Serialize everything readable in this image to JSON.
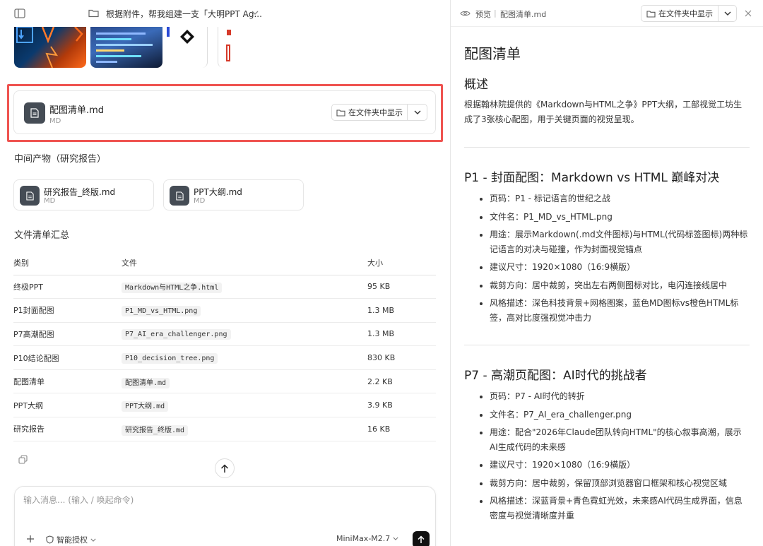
{
  "topbar": {
    "conversation_title": "根据附件，帮我组建一支「大明PPT Ag..."
  },
  "thumbnails": [
    "cover-thumbnail",
    "code-thumbnail",
    "decision-tree-thumbnail",
    "partial-thumbnail"
  ],
  "highlight_color": "#ef5350",
  "main_file": {
    "name": "配图清单.md",
    "type": "MD",
    "show_label": "在文件夹中显示"
  },
  "intermediate": {
    "title": "中间产物（研究报告）",
    "files": [
      {
        "name": "研究报告_终版.md",
        "type": "MD"
      },
      {
        "name": "PPT大纲.md",
        "type": "MD"
      }
    ]
  },
  "summary": {
    "title": "文件清单汇总",
    "headers": [
      "类别",
      "文件",
      "大小"
    ],
    "rows": [
      {
        "category": "终极PPT",
        "file": "Markdown与HTML之争.html",
        "size": "95 KB"
      },
      {
        "category": "P1封面配图",
        "file": "P1_MD_vs_HTML.png",
        "size": "1.3 MB"
      },
      {
        "category": "P7高潮配图",
        "file": "P7_AI_era_challenger.png",
        "size": "1.3 MB"
      },
      {
        "category": "P10结论配图",
        "file": "P10_decision_tree.png",
        "size": "830 KB"
      },
      {
        "category": "配图清单",
        "file": "配图清单.md",
        "size": "2.2 KB"
      },
      {
        "category": "PPT大纲",
        "file": "PPT大纲.md",
        "size": "3.9 KB"
      },
      {
        "category": "研究报告",
        "file": "研究报告_终版.md",
        "size": "16 KB"
      }
    ]
  },
  "composer": {
    "placeholder": "输入消息... (输入 / 唤起命令)",
    "permission_label": "智能授权",
    "model_label": "MiniMax-M2.7"
  },
  "preview": {
    "label": "预览",
    "separator": "|",
    "file_name": "配图清单.md",
    "show_label": "在文件夹中显示",
    "doc": {
      "title": "配图清单",
      "overview_heading": "概述",
      "overview_text": "根据翰林院提供的《Markdown与HTML之争》PPT大纲，工部视觉工坊生成了3张核心配图，用于关键页面的视觉呈现。",
      "sections": [
        {
          "heading": "P1 - 封面配图：Markdown vs HTML 巅峰对决",
          "items": [
            "页码：P1 - 标记语言的世纪之战",
            "文件名：P1_MD_vs_HTML.png",
            "用途：展示Markdown(.md文件图标)与HTML(代码标签图标)两种标记语言的对决与碰撞，作为封面视觉锚点",
            "建议尺寸：1920×1080（16:9横版）",
            "裁剪方向：居中裁剪，突出左右两侧图标对比，电闪连接线居中",
            "风格描述：深色科技背景+网格图案，蓝色MD图标vs橙色HTML标签，高对比度强视觉冲击力"
          ]
        },
        {
          "heading": "P7 - 高潮页配图：AI时代的挑战者",
          "items": [
            "页码：P7 - AI时代的转折",
            "文件名：P7_AI_era_challenger.png",
            "用途：配合\"2026年Claude团队转向HTML\"的核心叙事高潮，展示AI生成代码的未来感",
            "建议尺寸：1920×1080（16:9横版）",
            "裁剪方向：居中裁剪，保留顶部浏览器窗口框架和核心视觉区域",
            "风格描述：深蓝背景+青色霓虹光效，未来感AI代码生成界面，信息密度与视觉清晰度并重"
          ]
        }
      ]
    }
  }
}
